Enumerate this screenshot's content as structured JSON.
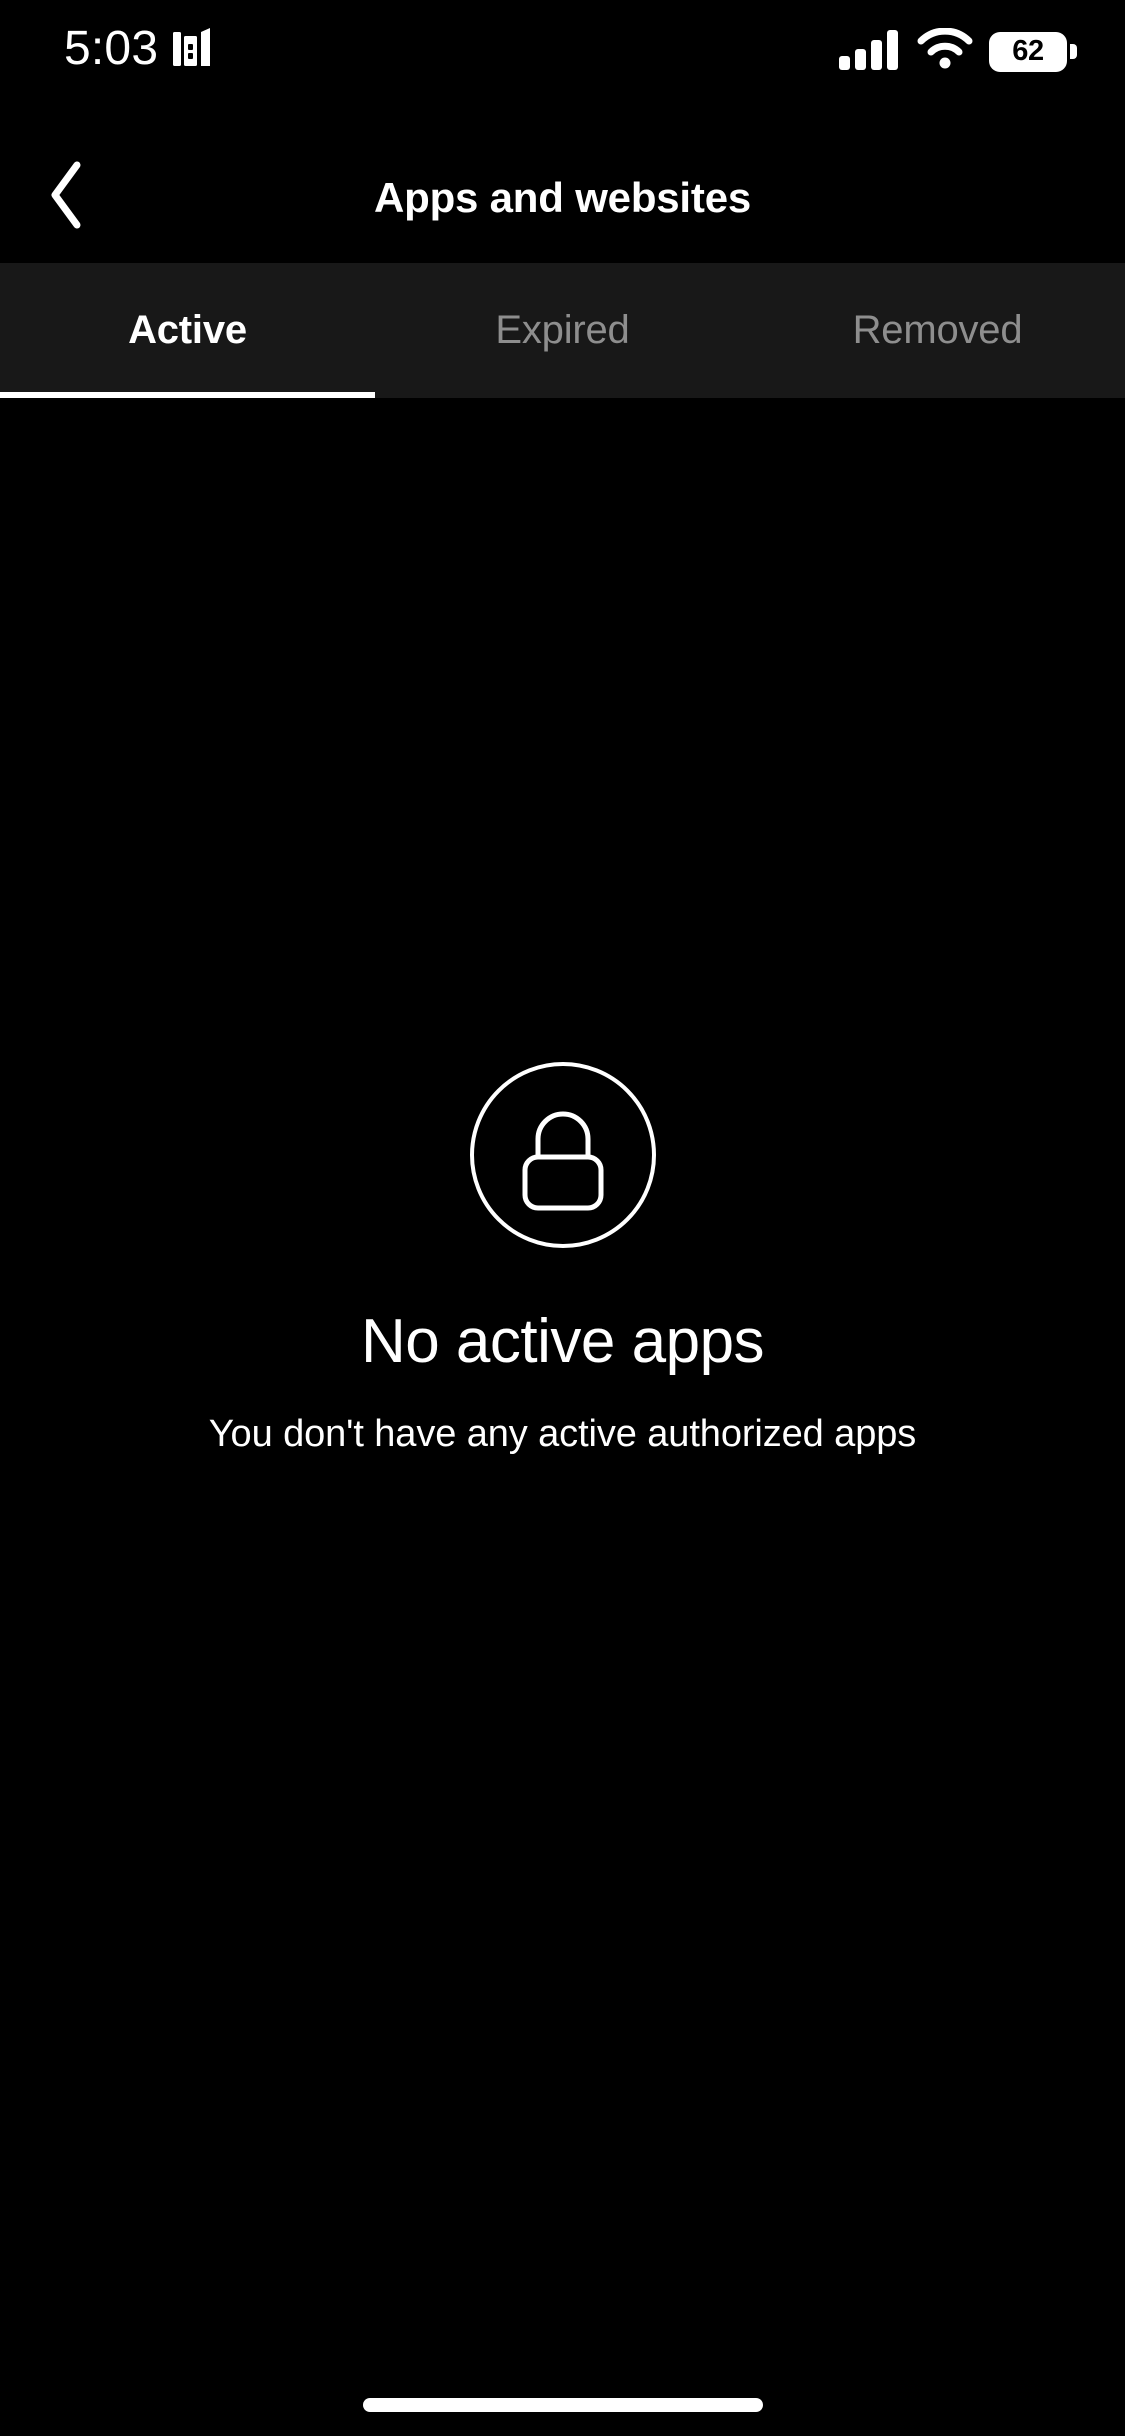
{
  "status_bar": {
    "time": "5:03",
    "active_app_icon": "books-icon",
    "cellular_icon": "cellular-signal-icon",
    "cellular_bars_filled": 4,
    "cellular_bars_total": 4,
    "wifi_icon": "wifi-icon",
    "battery_icon": "battery-icon",
    "battery_percent": "62"
  },
  "nav": {
    "back_icon": "chevron-left-icon",
    "title": "Apps and websites"
  },
  "tabs": [
    {
      "label": "Active",
      "active": true
    },
    {
      "label": "Expired",
      "active": false
    },
    {
      "label": "Removed",
      "active": false
    }
  ],
  "empty_state": {
    "icon": "lock-circle-icon",
    "title": "No active apps",
    "subtitle": "You don't have any active authorized apps"
  },
  "home_indicator": {
    "name": "home-indicator"
  },
  "colors": {
    "background": "#000000",
    "tab_bar_background": "#181818",
    "text_primary": "#ffffff",
    "text_inactive": "#8e8e8e",
    "indicator": "#ffffff"
  }
}
